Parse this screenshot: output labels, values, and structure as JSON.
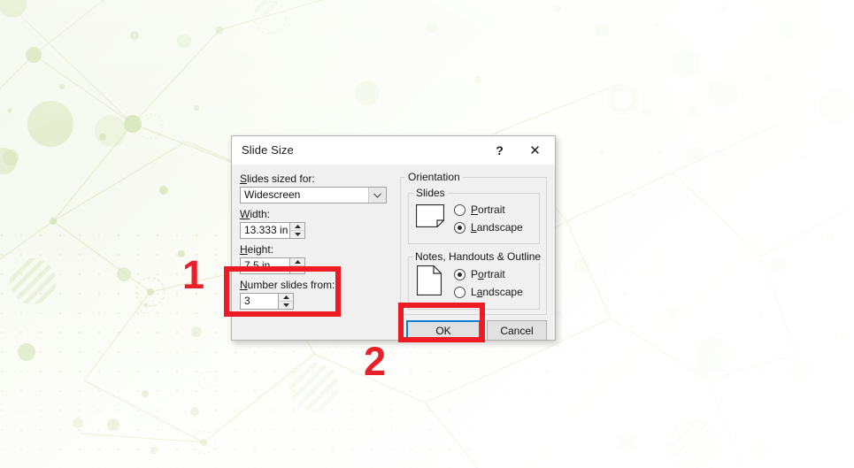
{
  "background": {
    "description": "green-network-pattern-slide"
  },
  "dialog": {
    "title": "Slide Size",
    "help_icon_label": "?",
    "close_icon_label": "✕",
    "left_panel": {
      "slides_sized_for": {
        "label_prefix": "S",
        "label_rest": "lides sized for:",
        "value": "Widescreen",
        "options": [
          "Widescreen"
        ]
      },
      "width": {
        "label_prefix": "W",
        "label_rest": "idth:",
        "value": "13.333 in"
      },
      "height": {
        "label_prefix": "H",
        "label_rest": "eight:",
        "value": "7.5 in"
      },
      "number_slides_from": {
        "label_prefix": "N",
        "label_rest": "umber slides from:",
        "value": "3"
      }
    },
    "orientation": {
      "legend": "Orientation",
      "slides": {
        "legend": "Slides",
        "icon": "landscape-page-icon",
        "options": [
          {
            "prefix": "P",
            "rest": "ortrait",
            "selected": false
          },
          {
            "prefix": "L",
            "rest": "andscape",
            "selected": true
          }
        ]
      },
      "notes": {
        "legend": "Notes, Handouts & Outline",
        "icon": "portrait-page-icon",
        "options": [
          {
            "prefix": "P",
            "rest": "ortrait",
            "selected": true,
            "mnemonic_at": 1
          },
          {
            "prefix": "L",
            "rest": "andscape",
            "selected": false,
            "mnemonic_at": 1
          }
        ]
      }
    },
    "buttons": {
      "ok": "OK",
      "cancel": "Cancel"
    }
  },
  "annotations": {
    "step_one": "1",
    "step_two": "2",
    "color": "#ed1c24"
  }
}
